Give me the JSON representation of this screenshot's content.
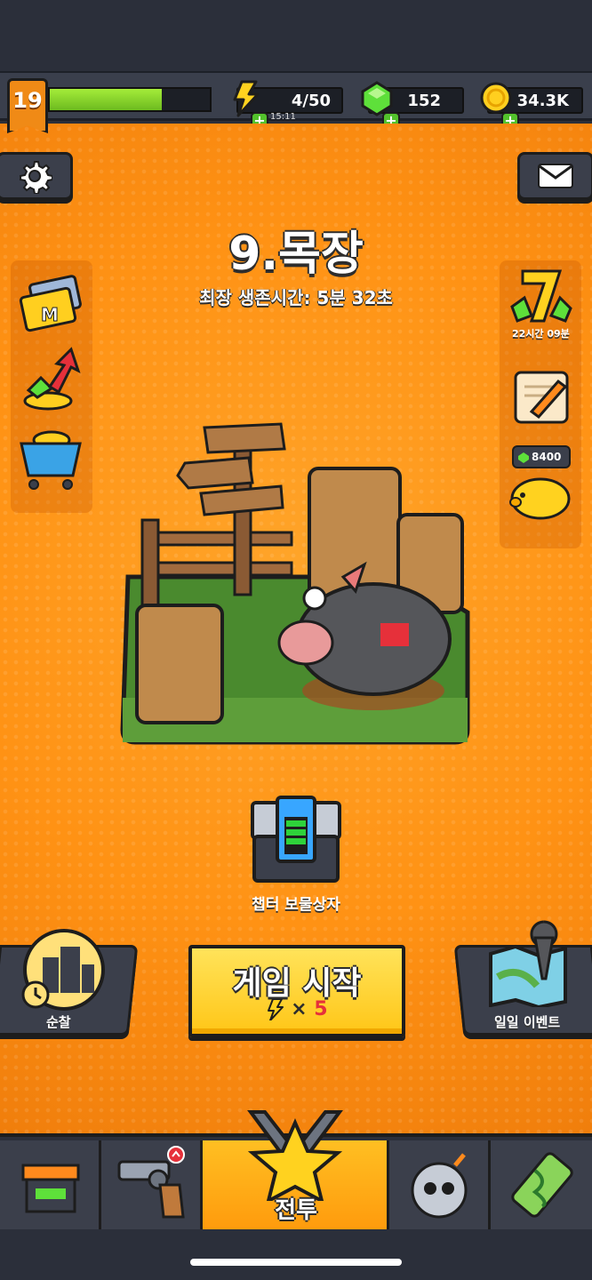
{
  "hud": {
    "level": "19",
    "xp_fraction": 0.7,
    "energy": "4/50",
    "energy_timer": "15:11",
    "gems": "152",
    "coins": "34.3K"
  },
  "stage": {
    "title": "9.목장",
    "best_survival": "최장 생존시간: 5분 32초"
  },
  "right_panel": {
    "lucky_timer": "22시간 09분",
    "piggy_gems": "8400"
  },
  "chest": {
    "label": "챕터 보물상자"
  },
  "actions": {
    "patrol_label": "순찰",
    "start_label": "게임 시작",
    "start_cost_symbol": "×",
    "start_cost": "5",
    "event_label": "일일 이벤트"
  },
  "nav": {
    "battle_label": "전투"
  },
  "colors": {
    "accent_orange": "#ff9214",
    "panel_dark": "#3b3f4b",
    "start_yellow": "#ffd22b",
    "xp_green": "#8ddb2e"
  }
}
